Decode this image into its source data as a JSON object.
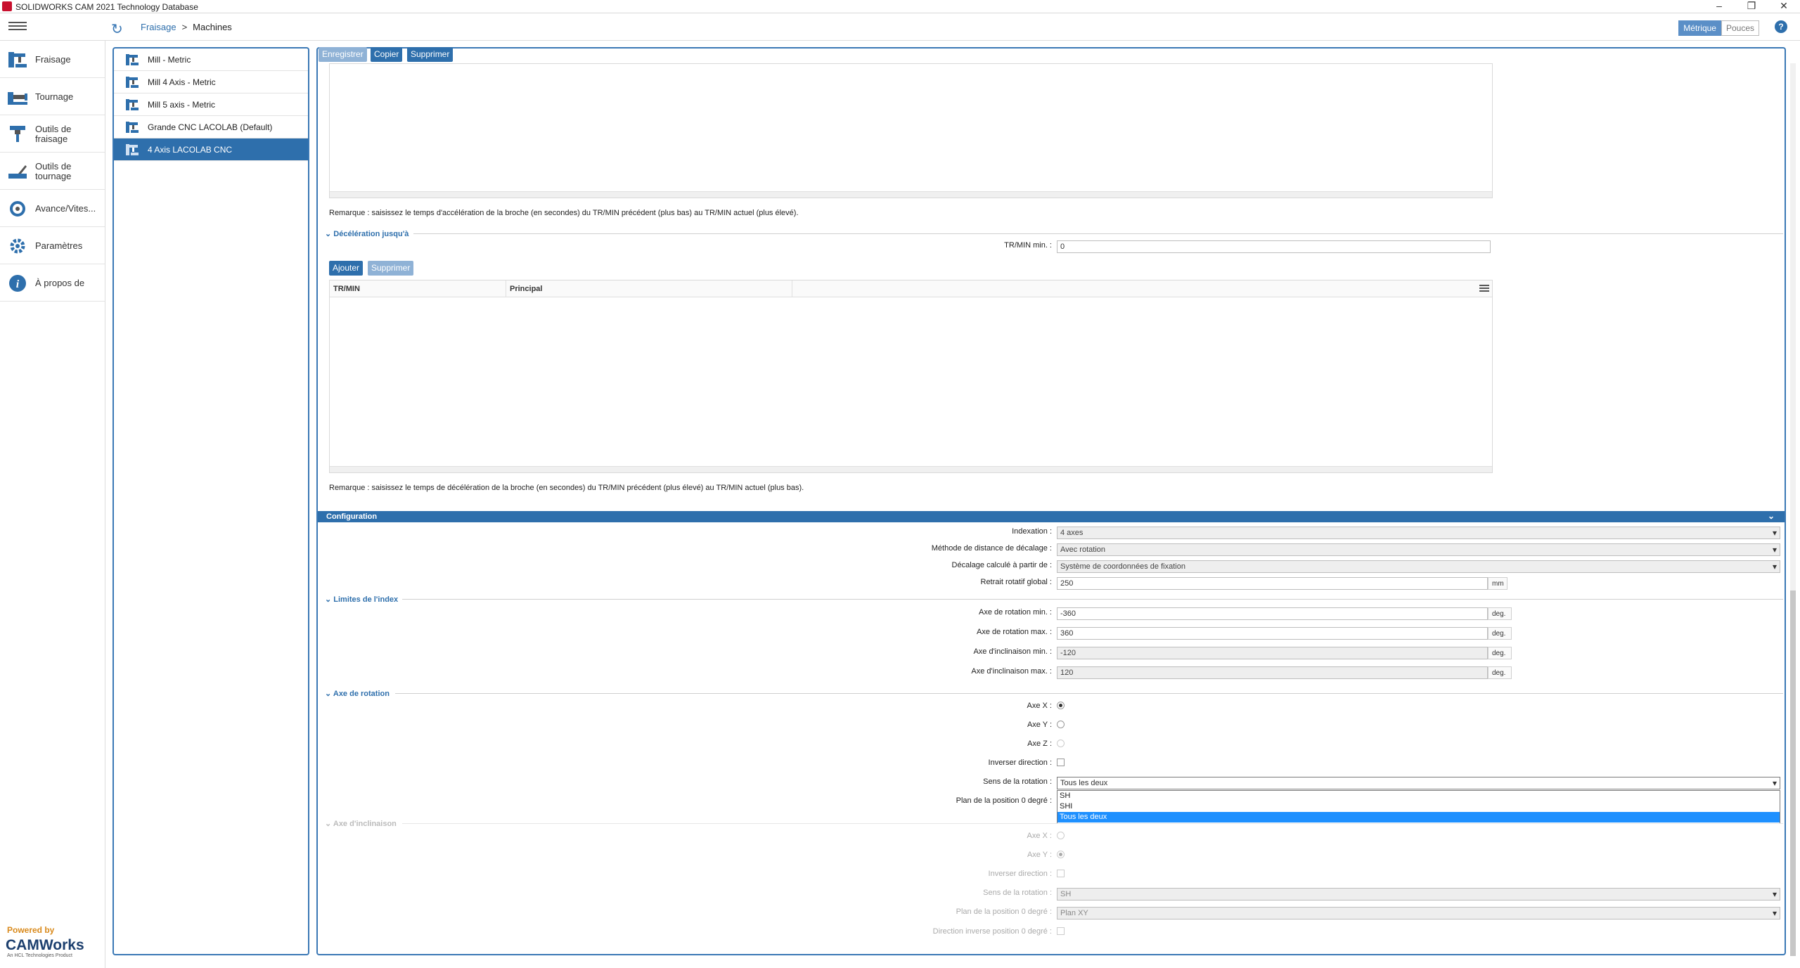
{
  "window": {
    "title": "SOLIDWORKS CAM 2021 Technology Database",
    "controls": [
      "–",
      "❐",
      "✕"
    ]
  },
  "breadcrumb": {
    "root": "Fraisage",
    "sep": ">",
    "current": "Machines"
  },
  "units": {
    "metric": "Métrique",
    "inch": "Pouces",
    "help": "?"
  },
  "leftnav": {
    "items": [
      {
        "label": "Fraisage",
        "icon": "milling-machine-icon"
      },
      {
        "label": "Tournage",
        "icon": "lathe-icon"
      },
      {
        "label": "Outils de fraisage",
        "icon": "mill-tool-icon"
      },
      {
        "label": "Outils de tournage",
        "icon": "turn-tool-icon"
      },
      {
        "label": "Avance/Vites...",
        "icon": "feed-speed-icon"
      },
      {
        "label": "Paramètres",
        "icon": "gear-icon"
      },
      {
        "label": "À propos de",
        "icon": "info-icon"
      }
    ],
    "powered_by": "Powered by",
    "brand": "CAMWorks",
    "brand_sub": "An HCL Technologies Product"
  },
  "machines": [
    {
      "label": "Mill - Metric",
      "selected": false
    },
    {
      "label": "Mill 4 Axis - Metric",
      "selected": false
    },
    {
      "label": "Mill 5 axis - Metric",
      "selected": false
    },
    {
      "label": "Grande CNC LACOLAB (Default)",
      "selected": false
    },
    {
      "label": "4 Axis LACOLAB CNC",
      "selected": true
    }
  ],
  "toolbar": {
    "save": "Enregistrer",
    "copy": "Copier",
    "delete": "Supprimer"
  },
  "accel_note": "Remarque : saisissez le temps d'accélération de la broche (en secondes) du TR/MIN précédent (plus bas) au TR/MIN actuel (plus élevé).",
  "decel": {
    "header": "Décélération jusqu'à",
    "rpm_min_label": "TR/MIN min. :",
    "rpm_min_value": "0",
    "add": "Ajouter",
    "delete": "Supprimer",
    "columns": [
      "TR/MIN",
      "Principal"
    ],
    "note": "Remarque : saisissez le temps de décélération de la broche (en secondes) du TR/MIN précédent (plus élevé) au TR/MIN actuel (plus bas)."
  },
  "config": {
    "header": "Configuration",
    "indexation_label": "Indexation :",
    "indexation_value": "4 axes",
    "offset_method_label": "Méthode de distance de décalage :",
    "offset_method_value": "Avec rotation",
    "offset_from_label": "Décalage calculé à partir de :",
    "offset_from_value": "Système de coordonnées de fixation",
    "retract_label": "Retrait rotatif global :",
    "retract_value": "250",
    "retract_unit": "mm"
  },
  "index_limits": {
    "header": "Limites de l'index",
    "rot_min_label": "Axe de rotation min. :",
    "rot_min_value": "-360",
    "rot_max_label": "Axe de rotation max. :",
    "rot_max_value": "360",
    "tilt_min_label": "Axe d'inclinaison min. :",
    "tilt_min_value": "-120",
    "tilt_max_label": "Axe d'inclinaison max. :",
    "tilt_max_value": "120",
    "unit": "deg."
  },
  "rotation_axis": {
    "header": "Axe de rotation",
    "x_label": "Axe X :",
    "y_label": "Axe Y :",
    "z_label": "Axe Z :",
    "selected_axis": "X",
    "invert_label": "Inverser direction :",
    "sense_label": "Sens de la rotation :",
    "sense_value": "Tous les deux",
    "plane_label": "Plan de la position 0 degré :",
    "dropdown_options": [
      "SH",
      "SHI",
      "Tous les deux"
    ],
    "dropdown_highlighted": "Tous les deux"
  },
  "tilt_axis": {
    "header": "Axe d'inclinaison",
    "x_label": "Axe X :",
    "y_label": "Axe Y :",
    "selected_axis": "Y",
    "invert_label": "Inverser direction :",
    "sense_label": "Sens de la rotation :",
    "sense_value": "SH",
    "plane_label": "Plan de la position 0 degré :",
    "plane_value": "Plan XY",
    "reverse_label": "Direction inverse position 0 degré :"
  }
}
